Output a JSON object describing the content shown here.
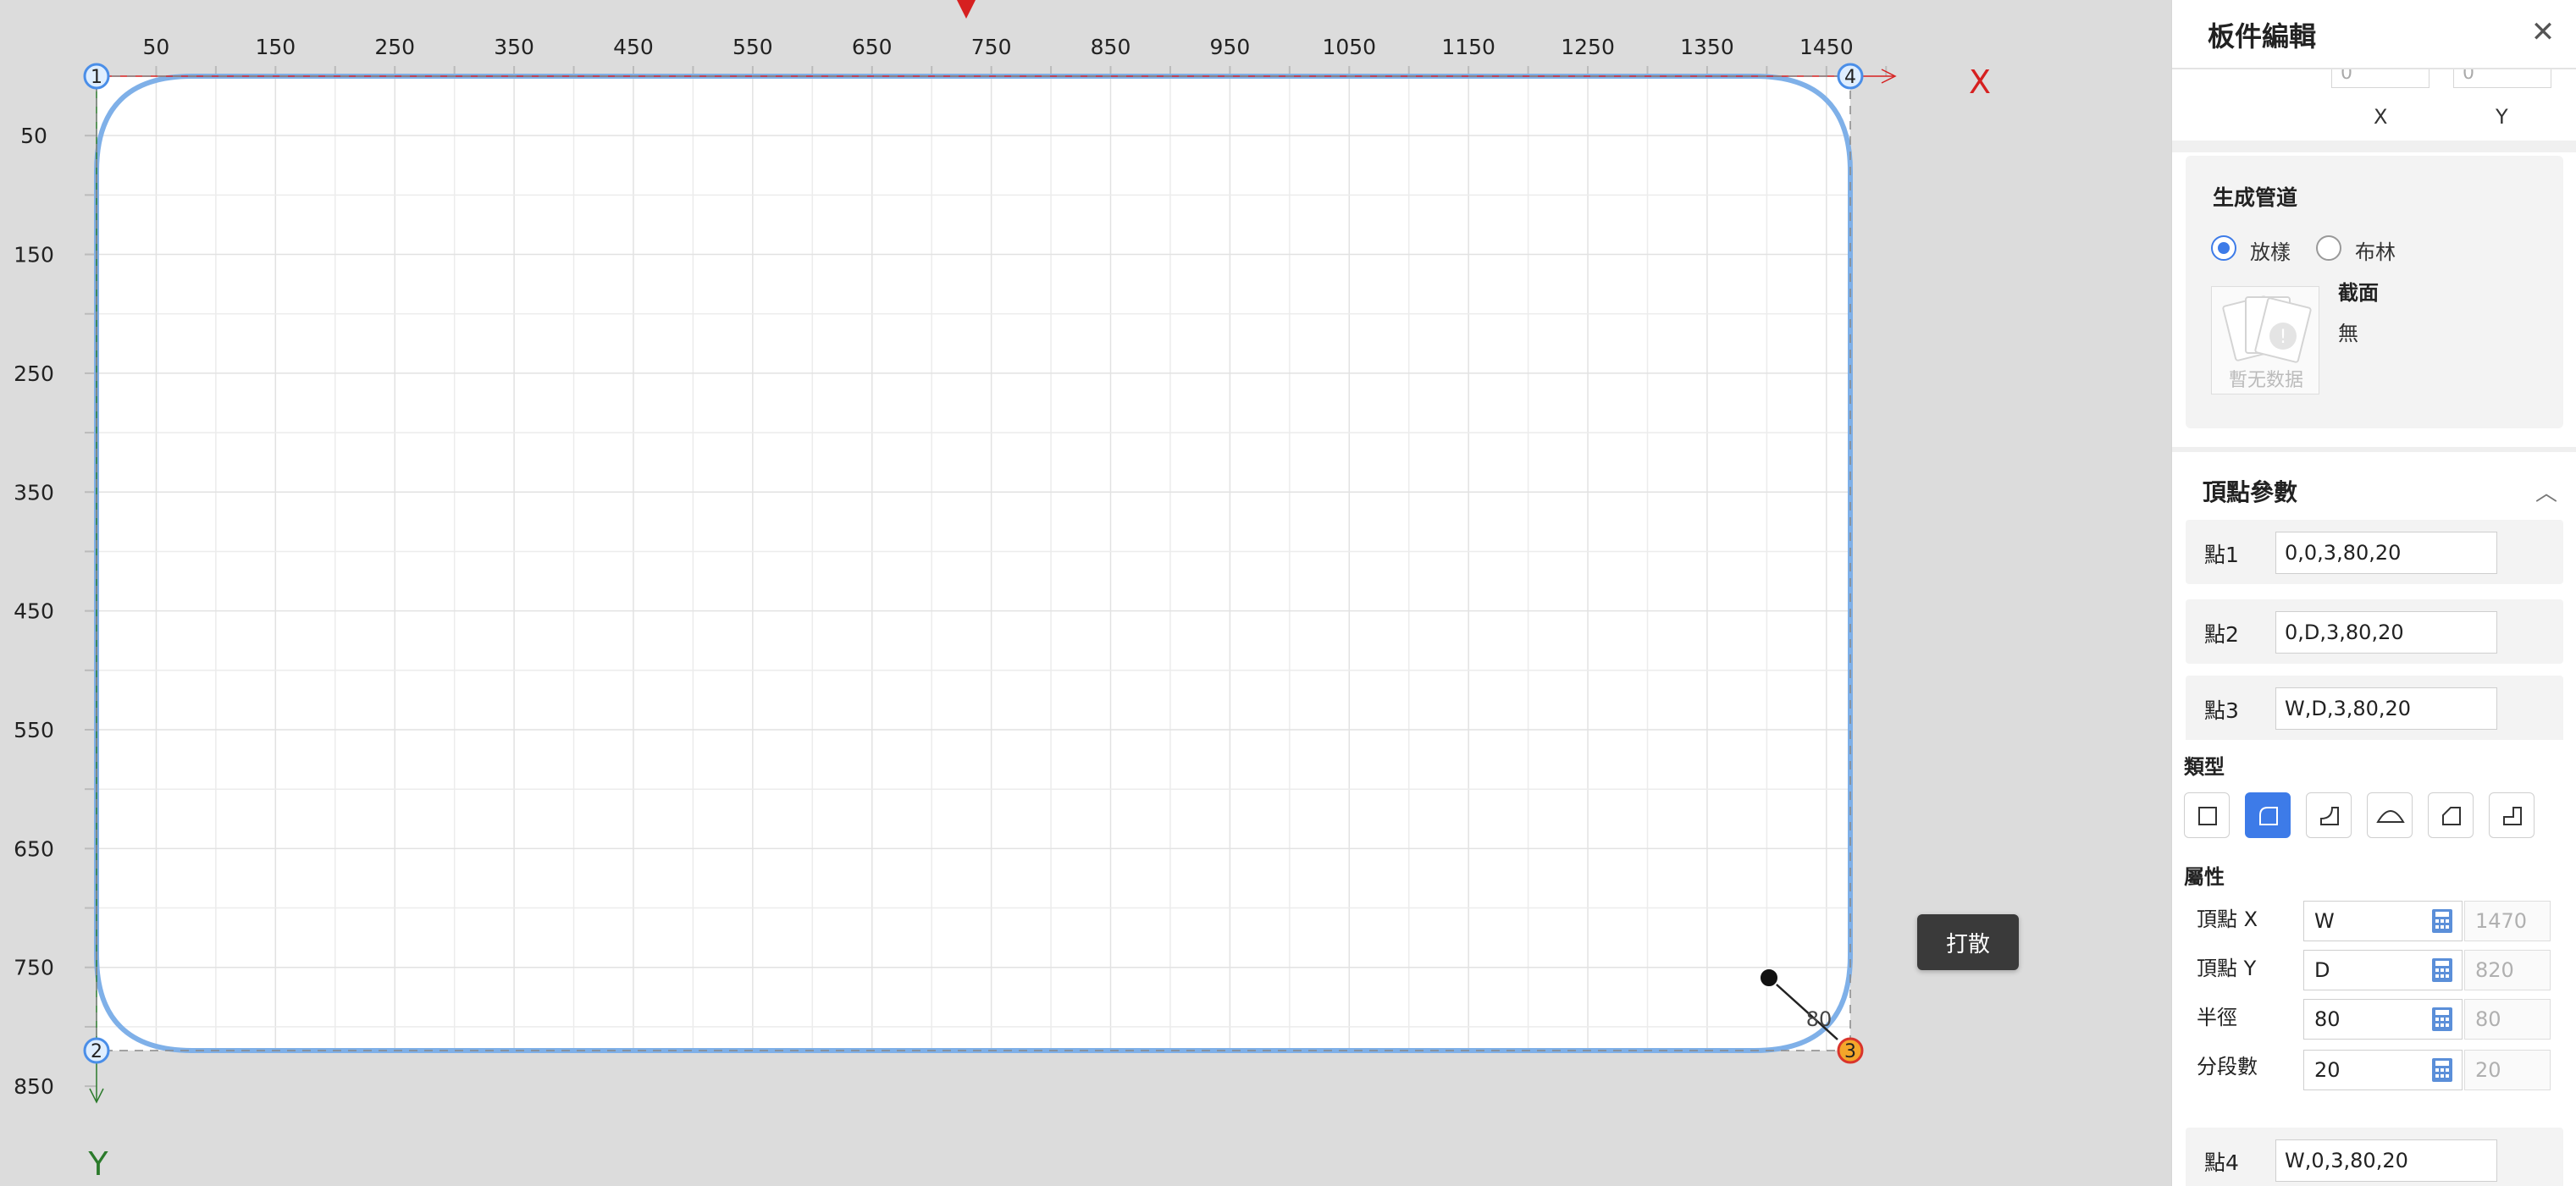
{
  "canvas": {
    "x_ticks": [
      "50",
      "150",
      "250",
      "350",
      "450",
      "550",
      "650",
      "750",
      "850",
      "950",
      "1050",
      "1150",
      "1250",
      "1350",
      "1450"
    ],
    "y_ticks": [
      "50",
      "150",
      "250",
      "350",
      "450",
      "550",
      "650",
      "750",
      "850"
    ],
    "x_axis_letter": "X",
    "y_axis_letter": "Y",
    "vertex_labels": [
      "1",
      "2",
      "3",
      "4"
    ],
    "radius_label": "80",
    "colors": {
      "outline": "#7fb0e8",
      "vertex_blue": "#4a8ee8",
      "vertex_active": "#f4a62a",
      "x_axis": "#d62020",
      "y_axis": "#2b7a2b",
      "marker": "#d62020"
    }
  },
  "scatter_button": {
    "label": "打散"
  },
  "panel": {
    "title": "板件編輯",
    "close_icon": "close-icon",
    "offset_row": {
      "x_label": "X",
      "y_label": "Y",
      "x_value": "0",
      "y_value": "0"
    },
    "pipeline": {
      "title": "生成管道",
      "options": [
        {
          "label": "放樣",
          "checked": true
        },
        {
          "label": "布林",
          "checked": false
        }
      ],
      "section_label": "截面",
      "section_value": "無",
      "thumb_text": "暫无数据"
    },
    "vertex_params": {
      "heading": "頂點參數",
      "points": [
        {
          "label": "點1",
          "value": "0,0,3,80,20"
        },
        {
          "label": "點2",
          "value": "0,D,3,80,20"
        },
        {
          "label": "點3",
          "value": "W,D,3,80,20"
        },
        {
          "label": "點4",
          "value": "W,0,3,80,20"
        }
      ],
      "type_heading": "類型",
      "type_icons": [
        "square-corner-icon",
        "round-corner-icon",
        "chamfer-corner-icon",
        "semicircle-icon",
        "bevel-corner-icon",
        "step-corner-icon"
      ],
      "selected_type_index": 1,
      "attr_heading": "屬性",
      "attributes": [
        {
          "label": "頂點 X",
          "value": "W",
          "result": "1470"
        },
        {
          "label": "頂點 Y",
          "value": "D",
          "result": "820"
        },
        {
          "label": "半徑",
          "value": "80",
          "result": "80"
        },
        {
          "label": "分段數",
          "value": "20",
          "result": "20"
        }
      ]
    }
  }
}
